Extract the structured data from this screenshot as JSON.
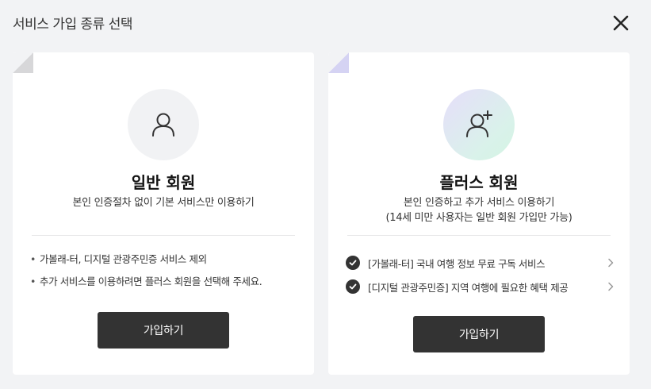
{
  "header": {
    "title": "서비스 가입 종류 선택",
    "close_icon": "close-icon"
  },
  "cards": {
    "general": {
      "icon": "user-icon",
      "title": "일반 회원",
      "description": "본인 인증절차 없이 기본 서비스만 이용하기",
      "notes": [
        "가볼래-터, 디지털 관광주민증 서비스 제외",
        "추가 서비스를 이용하려면 플러스 회원을 선택해 주세요."
      ],
      "join_label": "가입하기"
    },
    "plus": {
      "icon": "user-plus-icon",
      "title": "플러스 회원",
      "description_line1": "본인 인증하고 추가 서비스 이용하기",
      "description_line2": "(14세 미만 사용자는 일반 회원 가입만 가능)",
      "benefits": [
        "[가볼래-터] 국내 여행 정보 무료 구독 서비스",
        "[디지털 관광주민증] 지역 여행에 필요한 혜택 제공"
      ],
      "join_label": "가입하기"
    }
  },
  "colors": {
    "background": "#f2f3f5",
    "button": "#333333",
    "plus_gradient_start": "#e6defa",
    "plus_gradient_end": "#d4f4e3"
  }
}
